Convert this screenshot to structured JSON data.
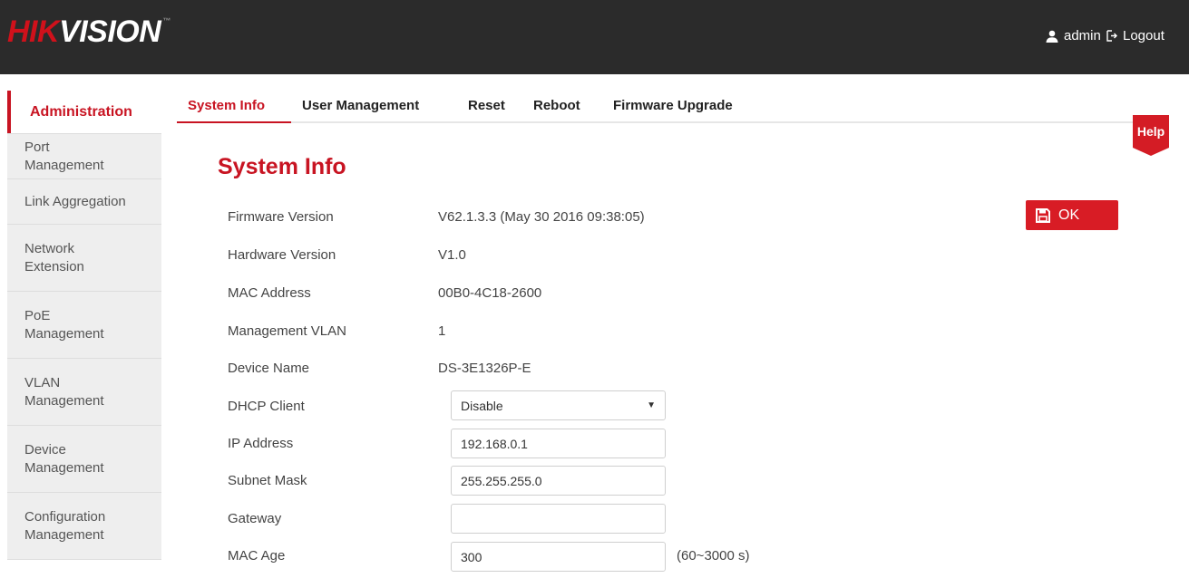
{
  "header": {
    "logo_hik": "HIK",
    "logo_vision": "VISION",
    "logo_tm": "™",
    "user": "admin",
    "logout": "Logout"
  },
  "sidebar": {
    "items": [
      {
        "lines": [
          "Administration"
        ],
        "active": true
      },
      {
        "lines": [
          "Port",
          "Management"
        ]
      },
      {
        "lines": [
          "Link Aggregation"
        ]
      },
      {
        "lines": [
          "Network",
          "Extension"
        ]
      },
      {
        "lines": [
          "PoE",
          "Management"
        ]
      },
      {
        "lines": [
          "VLAN",
          "Management"
        ]
      },
      {
        "lines": [
          "Device",
          "Management"
        ]
      },
      {
        "lines": [
          "Configuration",
          "Management"
        ]
      }
    ]
  },
  "tabs": [
    "System Info",
    "User Management",
    "Reset",
    "Reboot",
    "Firmware Upgrade"
  ],
  "help": "Help",
  "main": {
    "title": "System Info",
    "ok_label": "OK",
    "firmware_label": "Firmware Version",
    "firmware_value": "V62.1.3.3 (May 30 2016 09:38:05)",
    "hardware_label": "Hardware Version",
    "hardware_value": "V1.0",
    "mac_label": "MAC Address",
    "mac_value": "00B0-4C18-2600",
    "vlan_label": "Management VLAN",
    "vlan_value": "1",
    "device_label": "Device Name",
    "device_value": "DS-3E1326P-E",
    "dhcp_label": "DHCP Client",
    "dhcp_value": "Disable",
    "ip_label": "IP Address",
    "ip_value": "192.168.0.1",
    "subnet_label": "Subnet Mask",
    "subnet_value": "255.255.255.0",
    "gateway_label": "Gateway",
    "gateway_value": "",
    "macage_label": "MAC Age",
    "macage_value": "300",
    "macage_range": "(60~3000 s)"
  },
  "colors": {
    "brand_red": "#c81422",
    "header_bg": "#2b2b2b",
    "sidebar_bg": "#eeeeee"
  }
}
